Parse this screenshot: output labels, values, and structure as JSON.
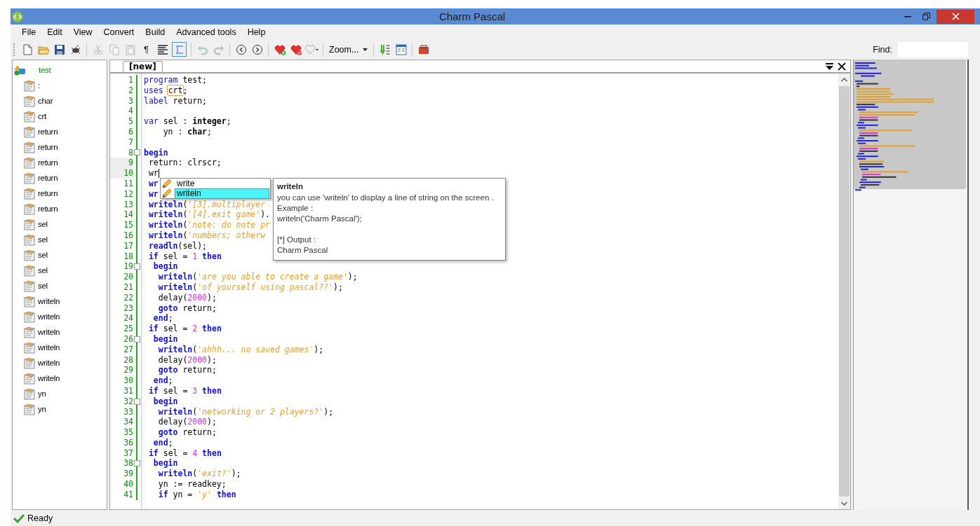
{
  "window": {
    "title": "Charm Pascal"
  },
  "menu": [
    {
      "label": "File"
    },
    {
      "label": "Edit"
    },
    {
      "label": "View"
    },
    {
      "label": "Convert"
    },
    {
      "label": "Build"
    },
    {
      "label": "Advanced tools"
    },
    {
      "label": "Help"
    }
  ],
  "toolbar": [
    {
      "kind": "new",
      "disabled": false
    },
    {
      "kind": "open",
      "disabled": false
    },
    {
      "kind": "save",
      "disabled": false
    },
    {
      "kind": "debug",
      "disabled": false
    },
    {
      "kind": "sep"
    },
    {
      "kind": "cut",
      "disabled": true
    },
    {
      "kind": "copy",
      "disabled": true
    },
    {
      "kind": "paste",
      "disabled": true
    },
    {
      "kind": "glyph",
      "text": "¶",
      "disabled": false
    },
    {
      "kind": "align",
      "disabled": false
    },
    {
      "kind": "region",
      "disabled": false
    },
    {
      "kind": "sep"
    },
    {
      "kind": "undo",
      "disabled": true
    },
    {
      "kind": "redo",
      "disabled": true
    },
    {
      "kind": "sep"
    },
    {
      "kind": "back",
      "disabled": false
    },
    {
      "kind": "forward",
      "disabled": false
    },
    {
      "kind": "sep"
    },
    {
      "kind": "heart-add",
      "disabled": false
    },
    {
      "kind": "heart-remove",
      "disabled": false
    },
    {
      "kind": "heart-menu",
      "disabled": false
    },
    {
      "kind": "sep"
    },
    {
      "kind": "zoom",
      "label": "Zoom...",
      "disabled": false
    },
    {
      "kind": "sep"
    },
    {
      "kind": "compile",
      "disabled": false
    },
    {
      "kind": "panel",
      "disabled": false
    },
    {
      "kind": "sep"
    },
    {
      "kind": "toolbox",
      "disabled": false
    }
  ],
  "find": {
    "label": "Find:"
  },
  "outline": {
    "label": "test",
    "children": [
      {
        "label": ":"
      },
      {
        "label": "char"
      },
      {
        "label": "crt"
      },
      {
        "label": "return"
      },
      {
        "label": "return"
      },
      {
        "label": "return"
      },
      {
        "label": "return"
      },
      {
        "label": "return"
      },
      {
        "label": "return"
      },
      {
        "label": "sel"
      },
      {
        "label": "sel"
      },
      {
        "label": "sel"
      },
      {
        "label": "sel"
      },
      {
        "label": "sel"
      },
      {
        "label": "writeln"
      },
      {
        "label": "writeln"
      },
      {
        "label": "writeln"
      },
      {
        "label": "writeln"
      },
      {
        "label": "writeln"
      },
      {
        "label": "writeln"
      },
      {
        "label": "yn"
      },
      {
        "label": "yn"
      }
    ]
  },
  "editor": {
    "tab": {
      "label": "[new]",
      "selected": true
    },
    "lines": [
      {
        "number": "1",
        "fold": false,
        "current": false,
        "caret": false,
        "tokens": [
          {
            "kind": "keyword",
            "text": "program"
          },
          {
            "kind": "plain",
            "text": " test;"
          }
        ]
      },
      {
        "number": "2",
        "fold": false,
        "current": false,
        "caret": false,
        "tokens": [
          {
            "kind": "keyword",
            "text": "uses "
          },
          {
            "kind": "match",
            "text": "crt"
          },
          {
            "kind": "plain",
            "text": ";"
          }
        ]
      },
      {
        "number": "3",
        "fold": false,
        "current": false,
        "caret": false,
        "tokens": [
          {
            "kind": "keyword",
            "text": "label"
          },
          {
            "kind": "plain",
            "text": " return;"
          }
        ]
      },
      {
        "number": "4",
        "fold": false,
        "current": false,
        "caret": false
      },
      {
        "number": "5",
        "fold": false,
        "current": false,
        "caret": false,
        "tokens": [
          {
            "kind": "keyword",
            "text": "var"
          },
          {
            "kind": "plain",
            "text": " sel : "
          },
          {
            "kind": "type",
            "text": "integer"
          },
          {
            "kind": "plain",
            "text": ";"
          }
        ]
      },
      {
        "number": "6",
        "fold": false,
        "current": false,
        "caret": false,
        "tokens": [
          {
            "kind": "plain",
            "text": "    yn : "
          },
          {
            "kind": "type",
            "text": "char"
          },
          {
            "kind": "plain",
            "text": ";"
          }
        ]
      },
      {
        "number": "7",
        "fold": false,
        "current": false,
        "caret": false
      },
      {
        "number": "8",
        "fold": true,
        "current": false,
        "caret": false,
        "tokens": [
          {
            "kind": "strong",
            "text": "begin"
          }
        ]
      },
      {
        "number": "9",
        "fold": false,
        "current": true,
        "caret": false,
        "tokens": [
          {
            "kind": "plain",
            "text": " return: clrscr;"
          }
        ]
      },
      {
        "number": "10",
        "fold": false,
        "current": true,
        "caret": true,
        "tokens": [
          {
            "kind": "plain",
            "text": " wr"
          }
        ]
      },
      {
        "number": "11",
        "fold": false,
        "current": false,
        "caret": false,
        "tokens": [
          {
            "kind": "strong",
            "text": " wr"
          }
        ]
      },
      {
        "number": "12",
        "fold": false,
        "current": false,
        "caret": false,
        "tokens": [
          {
            "kind": "strong",
            "text": " wr"
          }
        ]
      },
      {
        "number": "13",
        "fold": false,
        "current": false,
        "caret": false,
        "tokens": [
          {
            "kind": "strong",
            "text": " writeln"
          },
          {
            "kind": "plain",
            "text": "("
          },
          {
            "kind": "string",
            "text": "'[3].multiplayer"
          }
        ]
      },
      {
        "number": "14",
        "fold": false,
        "current": false,
        "caret": false,
        "tokens": [
          {
            "kind": "strong",
            "text": " writeln"
          },
          {
            "kind": "plain",
            "text": "("
          },
          {
            "kind": "string",
            "text": "'[4].exit game'"
          },
          {
            "kind": "plain",
            "text": ")."
          }
        ]
      },
      {
        "number": "15",
        "fold": false,
        "current": false,
        "caret": false,
        "tokens": [
          {
            "kind": "strong",
            "text": " writeln"
          },
          {
            "kind": "plain",
            "text": "("
          },
          {
            "kind": "string",
            "text": "'note: do note pr"
          }
        ]
      },
      {
        "number": "16",
        "fold": false,
        "current": false,
        "caret": false,
        "tokens": [
          {
            "kind": "strong",
            "text": " writeln"
          },
          {
            "kind": "plain",
            "text": "("
          },
          {
            "kind": "string",
            "text": "'numbers; otherw"
          }
        ]
      },
      {
        "number": "17",
        "fold": false,
        "current": false,
        "caret": false,
        "tokens": [
          {
            "kind": "strong",
            "text": " readln"
          },
          {
            "kind": "plain",
            "text": "(sel);"
          }
        ]
      },
      {
        "number": "18",
        "fold": false,
        "current": false,
        "caret": false,
        "tokens": [
          {
            "kind": "strong",
            "text": " if"
          },
          {
            "kind": "plain",
            "text": " sel = "
          },
          {
            "kind": "number",
            "text": "1"
          },
          {
            "kind": "strong",
            "text": " then"
          }
        ]
      },
      {
        "number": "19",
        "fold": true,
        "current": false,
        "caret": false,
        "tokens": [
          {
            "kind": "strong",
            "text": "  begin"
          }
        ]
      },
      {
        "number": "20",
        "fold": false,
        "current": false,
        "caret": false,
        "tokens": [
          {
            "kind": "strong",
            "text": "   writeln"
          },
          {
            "kind": "plain",
            "text": "("
          },
          {
            "kind": "string",
            "text": "'are you able to create a game'"
          },
          {
            "kind": "plain",
            "text": ");"
          }
        ]
      },
      {
        "number": "21",
        "fold": false,
        "current": false,
        "caret": false,
        "tokens": [
          {
            "kind": "strong",
            "text": "   writeln"
          },
          {
            "kind": "plain",
            "text": "("
          },
          {
            "kind": "string",
            "text": "'of yourself using pascal??'"
          },
          {
            "kind": "plain",
            "text": ");"
          }
        ]
      },
      {
        "number": "22",
        "fold": false,
        "current": false,
        "caret": false,
        "tokens": [
          {
            "kind": "plain",
            "text": "   delay("
          },
          {
            "kind": "number",
            "text": "2000"
          },
          {
            "kind": "plain",
            "text": ");"
          }
        ]
      },
      {
        "number": "23",
        "fold": false,
        "current": false,
        "caret": false,
        "tokens": [
          {
            "kind": "strong",
            "text": "   goto"
          },
          {
            "kind": "plain",
            "text": " return;"
          }
        ]
      },
      {
        "number": "24",
        "fold": false,
        "current": false,
        "caret": false,
        "tokens": [
          {
            "kind": "strong",
            "text": "  end"
          },
          {
            "kind": "plain",
            "text": ";"
          }
        ]
      },
      {
        "number": "25",
        "fold": false,
        "current": false,
        "caret": false,
        "tokens": [
          {
            "kind": "strong",
            "text": " if"
          },
          {
            "kind": "plain",
            "text": " sel = "
          },
          {
            "kind": "number",
            "text": "2"
          },
          {
            "kind": "strong",
            "text": " then"
          }
        ]
      },
      {
        "number": "26",
        "fold": true,
        "current": false,
        "caret": false,
        "tokens": [
          {
            "kind": "strong",
            "text": "  begin"
          }
        ]
      },
      {
        "number": "27",
        "fold": false,
        "current": false,
        "caret": false,
        "tokens": [
          {
            "kind": "strong",
            "text": "   writeln"
          },
          {
            "kind": "plain",
            "text": "("
          },
          {
            "kind": "string",
            "text": "'ahhh... no saved games'"
          },
          {
            "kind": "plain",
            "text": ");"
          }
        ]
      },
      {
        "number": "28",
        "fold": false,
        "current": false,
        "caret": false,
        "tokens": [
          {
            "kind": "plain",
            "text": "   delay("
          },
          {
            "kind": "number",
            "text": "2000"
          },
          {
            "kind": "plain",
            "text": ");"
          }
        ]
      },
      {
        "number": "29",
        "fold": false,
        "current": false,
        "caret": false,
        "tokens": [
          {
            "kind": "strong",
            "text": "   goto"
          },
          {
            "kind": "plain",
            "text": " return;"
          }
        ]
      },
      {
        "number": "30",
        "fold": false,
        "current": false,
        "caret": false,
        "tokens": [
          {
            "kind": "strong",
            "text": "  end"
          },
          {
            "kind": "plain",
            "text": ";"
          }
        ]
      },
      {
        "number": "31",
        "fold": false,
        "current": false,
        "caret": false,
        "tokens": [
          {
            "kind": "strong",
            "text": " if"
          },
          {
            "kind": "plain",
            "text": " sel = "
          },
          {
            "kind": "number",
            "text": "3"
          },
          {
            "kind": "strong",
            "text": " then"
          }
        ]
      },
      {
        "number": "32",
        "fold": true,
        "current": false,
        "caret": false,
        "tokens": [
          {
            "kind": "strong",
            "text": "  begin"
          }
        ]
      },
      {
        "number": "33",
        "fold": false,
        "current": false,
        "caret": false,
        "tokens": [
          {
            "kind": "strong",
            "text": "   writeln"
          },
          {
            "kind": "plain",
            "text": "("
          },
          {
            "kind": "string",
            "text": "'networking or 2 players?'"
          },
          {
            "kind": "plain",
            "text": ");"
          }
        ]
      },
      {
        "number": "34",
        "fold": false,
        "current": false,
        "caret": false,
        "tokens": [
          {
            "kind": "plain",
            "text": "   delay("
          },
          {
            "kind": "number",
            "text": "2000"
          },
          {
            "kind": "plain",
            "text": ");"
          }
        ]
      },
      {
        "number": "35",
        "fold": false,
        "current": false,
        "caret": false,
        "tokens": [
          {
            "kind": "strong",
            "text": "   goto"
          },
          {
            "kind": "plain",
            "text": " return;"
          }
        ]
      },
      {
        "number": "36",
        "fold": false,
        "current": false,
        "caret": false,
        "tokens": [
          {
            "kind": "strong",
            "text": "  end"
          },
          {
            "kind": "plain",
            "text": ";"
          }
        ]
      },
      {
        "number": "37",
        "fold": false,
        "current": false,
        "caret": false,
        "tokens": [
          {
            "kind": "strong",
            "text": " if"
          },
          {
            "kind": "plain",
            "text": " sel = "
          },
          {
            "kind": "number",
            "text": "4"
          },
          {
            "kind": "strong",
            "text": " then"
          }
        ]
      },
      {
        "number": "38",
        "fold": true,
        "current": false,
        "caret": false,
        "tokens": [
          {
            "kind": "strong",
            "text": "  begin"
          }
        ]
      },
      {
        "number": "39",
        "fold": false,
        "current": false,
        "caret": false,
        "tokens": [
          {
            "kind": "strong",
            "text": "   writeln"
          },
          {
            "kind": "plain",
            "text": "("
          },
          {
            "kind": "string",
            "text": "'exit?'"
          },
          {
            "kind": "plain",
            "text": ");"
          }
        ]
      },
      {
        "number": "40",
        "fold": false,
        "current": false,
        "caret": false,
        "tokens": [
          {
            "kind": "plain",
            "text": "   yn := readkey;"
          }
        ]
      },
      {
        "number": "41",
        "fold": false,
        "current": false,
        "caret": false,
        "tokens": [
          {
            "kind": "strong",
            "text": "   if"
          },
          {
            "kind": "plain",
            "text": " yn = "
          },
          {
            "kind": "string",
            "text": "'y'"
          },
          {
            "kind": "strong",
            "text": " then"
          }
        ]
      }
    ]
  },
  "autocomplete": {
    "items": [
      {
        "label": "write",
        "selected": false
      },
      {
        "label": "writeln",
        "selected": true
      }
    ]
  },
  "tooltip": {
    "title": "writeln",
    "sections": [
      [
        "you can use 'writeln' to display a line of string on the screen .",
        "Example :",
        "writeln('Charm Pascal');"
      ],
      [
        "[*] Output :",
        "Charm Pascal"
      ]
    ]
  },
  "status_bar": {
    "text": "Ready"
  }
}
